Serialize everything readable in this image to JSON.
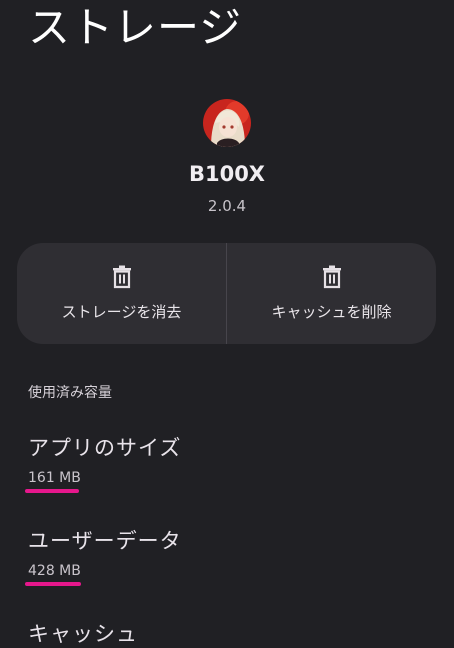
{
  "page": {
    "title": "ストレージ"
  },
  "app": {
    "name": "B100X",
    "version": "2.0.4"
  },
  "actions": {
    "clear_storage": "ストレージを消去",
    "clear_cache": "キャッシュを削除"
  },
  "usage": {
    "header": "使用済み容量",
    "items": [
      {
        "label": "アプリのサイズ",
        "value": "161 MB"
      },
      {
        "label": "ユーザーデータ",
        "value": "428 MB"
      },
      {
        "label": "キャッシュ",
        "value": ""
      }
    ]
  },
  "colors": {
    "background": "#202024",
    "card": "#2f2e33",
    "highlight_underline": "#e6178c"
  }
}
